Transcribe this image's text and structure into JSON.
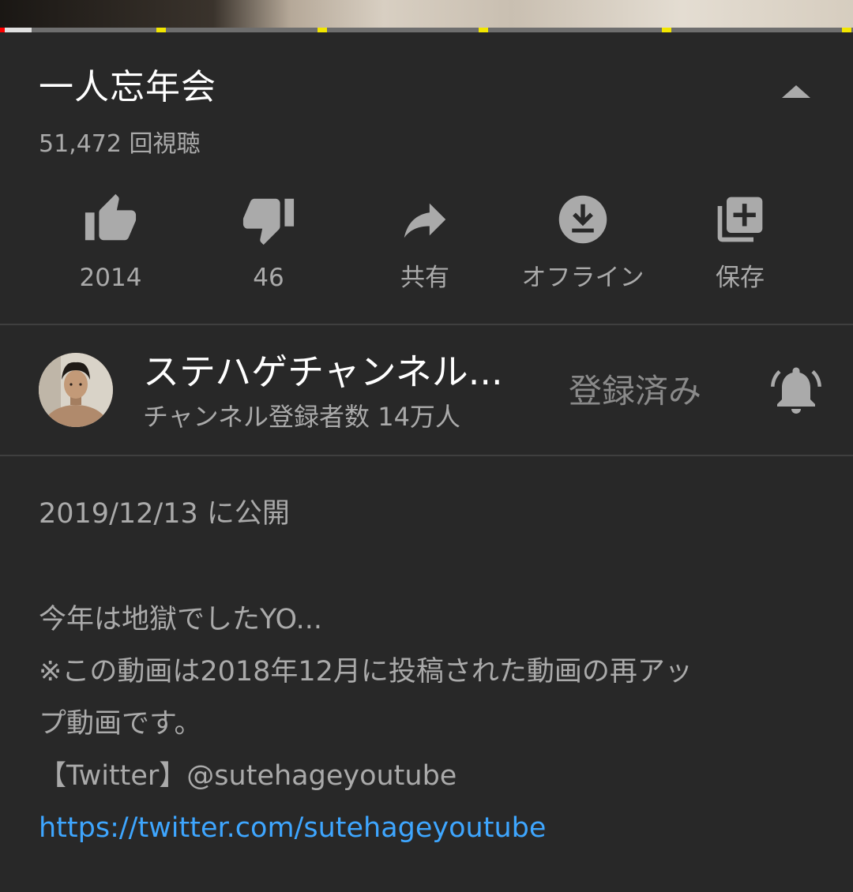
{
  "video": {
    "title": "一人忘年会",
    "views": "51,472 回視聴",
    "progress": 0.037
  },
  "actions": {
    "like": "2014",
    "dislike": "46",
    "share": "共有",
    "offline": "オフライン",
    "save": "保存"
  },
  "channel": {
    "name": "ステハゲチャンネル...",
    "subscribers": "チャンネル登録者数 14万人",
    "subscribe_state": "登録済み"
  },
  "description": {
    "published": "2019/12/13 に公開",
    "line1": "今年は地獄でしたYO...",
    "line2": "※この動画は2018年12月に投稿された動画の再アッ",
    "line3": "プ動画です。",
    "line4": "【Twitter】@sutehageyoutube",
    "link": "https://twitter.com/sutehageyoutube"
  },
  "colors": {
    "background": "#282828",
    "secondary_text": "#aaaaaa",
    "link": "#3ea6ff",
    "progress_played": "#ff0000",
    "ad_marker": "#f2e600"
  },
  "icons": {
    "collapse": "chevron-up-icon",
    "like": "thumb-up-icon",
    "dislike": "thumb-down-icon",
    "share": "share-arrow-icon",
    "offline": "download-icon",
    "save": "add-to-playlist-icon",
    "notifications": "bell-icon"
  }
}
